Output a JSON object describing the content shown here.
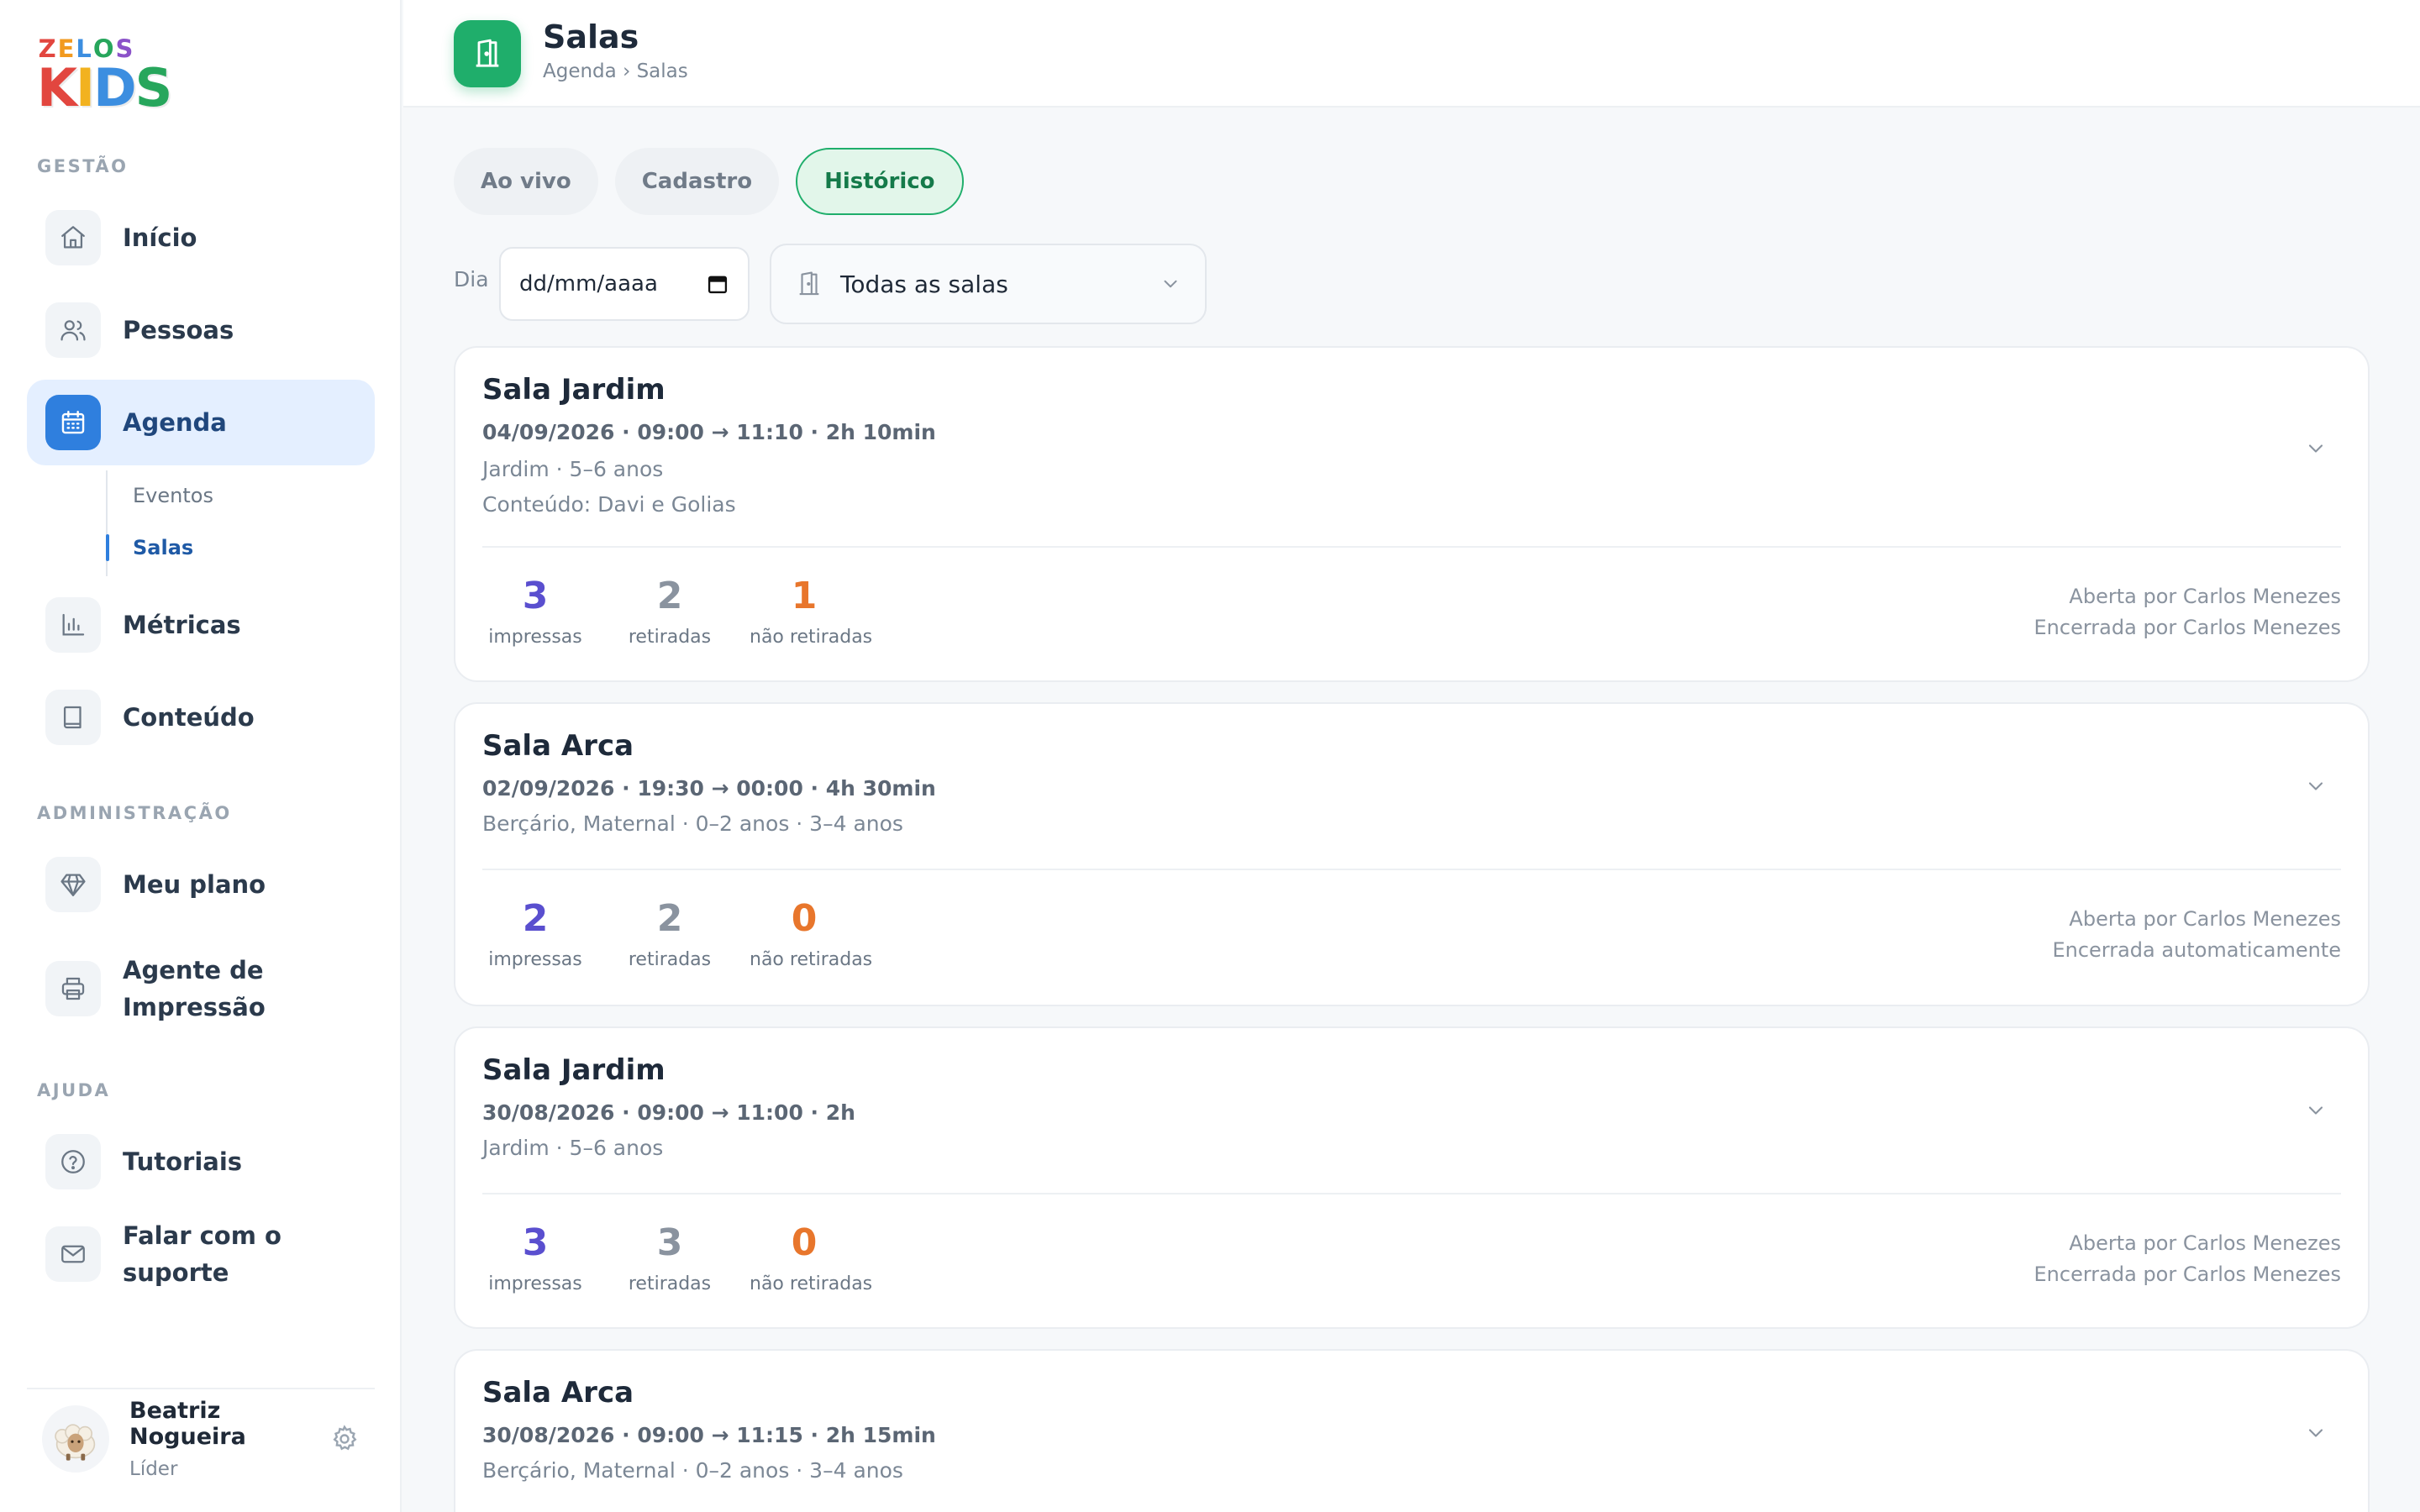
{
  "brand": {
    "logo_top": "ZELOS",
    "logo_bottom": "KIDS"
  },
  "sidebar": {
    "sections": {
      "gestao": "GESTÃO",
      "administracao": "ADMINISTRAÇÃO",
      "ajuda": "AJUDA"
    },
    "items": {
      "inicio": "Início",
      "pessoas": "Pessoas",
      "agenda": "Agenda",
      "eventos": "Eventos",
      "salas": "Salas",
      "metricas": "Métricas",
      "conteudo": "Conteúdo",
      "meu_plano": "Meu plano",
      "agente_l1": "Agente de",
      "agente_l2": "Impressão",
      "tutoriais": "Tutoriais",
      "suporte": "Falar com o suporte"
    },
    "user": {
      "name": "Beatriz Nogueira",
      "role": "Líder"
    }
  },
  "header": {
    "title": "Salas",
    "breadcrumb": "Agenda › Salas"
  },
  "tabs": {
    "live": "Ao vivo",
    "register": "Cadastro",
    "history": "Histórico"
  },
  "filters": {
    "day_label": "Dia",
    "date_placeholder": "dd/mm/aaaa",
    "room_select": "Todas as salas"
  },
  "labels": {
    "printed": "impressas",
    "taken": "retiradas",
    "not_taken": "não retiradas"
  },
  "sessions": [
    {
      "room": "Sala Jardim",
      "time": "04/09/2026 · 09:00 → 11:10 · 2h 10min",
      "groups": "Jardim · 5–6 anos",
      "content": "Conteúdo: Davi e Golias",
      "printed": "3",
      "taken": "2",
      "not_taken": "1",
      "opened_by": "Aberta por Carlos Menezes",
      "closed_by": "Encerrada por Carlos Menezes"
    },
    {
      "room": "Sala Arca",
      "time": "02/09/2026 · 19:30 → 00:00 · 4h 30min",
      "groups": "Berçário, Maternal · 0–2 anos · 3–4 anos",
      "printed": "2",
      "taken": "2",
      "not_taken": "0",
      "opened_by": "Aberta por Carlos Menezes",
      "closed_by": "Encerrada automaticamente"
    },
    {
      "room": "Sala Jardim",
      "time": "30/08/2026 · 09:00 → 11:00 · 2h",
      "groups": "Jardim · 5–6 anos",
      "printed": "3",
      "taken": "3",
      "not_taken": "0",
      "opened_by": "Aberta por Carlos Menezes",
      "closed_by": "Encerrada por Carlos Menezes"
    },
    {
      "room": "Sala Arca",
      "time": "30/08/2026 · 09:00 → 11:15 · 2h 15min",
      "groups": "Berçário, Maternal · 0–2 anos · 3–4 anos"
    }
  ],
  "colors": {
    "accent_green": "#1fae6b",
    "accent_blue": "#2f7fde",
    "printed": "#5a4fcf",
    "taken": "#8a939f",
    "not_taken": "#e8762c"
  }
}
